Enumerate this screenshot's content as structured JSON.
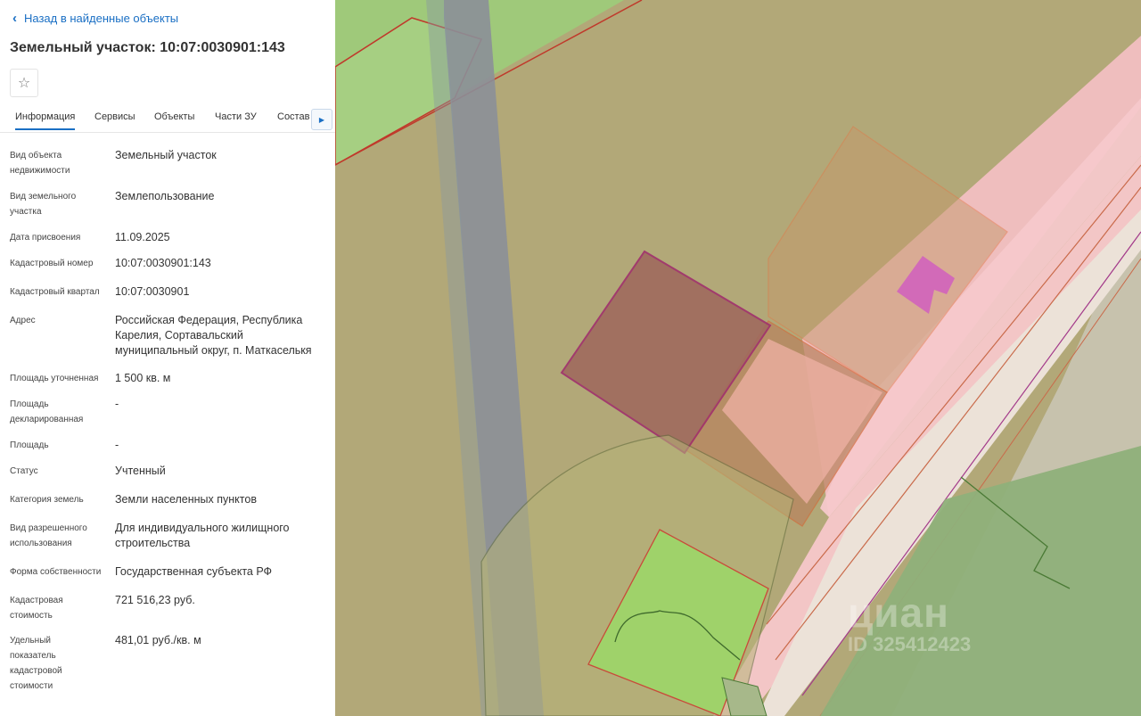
{
  "nav": {
    "back_label": "Назад в найденные объекты"
  },
  "header": {
    "title": "Земельный участок: 10:07:0030901:143"
  },
  "tabs": [
    {
      "label": "Информация",
      "active": true
    },
    {
      "label": "Сервисы"
    },
    {
      "label": "Объекты"
    },
    {
      "label": "Части ЗУ"
    },
    {
      "label": "Состав"
    }
  ],
  "details": [
    {
      "label": "Вид объекта недвижимости",
      "value": "Земельный участок"
    },
    {
      "label": "Вид земельного участка",
      "value": "Землепользование"
    },
    {
      "label": "Дата присвоения",
      "value": "11.09.2025"
    },
    {
      "label": "Кадастровый номер",
      "value": "10:07:0030901:143"
    },
    {
      "label": "Кадастровый квартал",
      "value": "10:07:0030901"
    },
    {
      "label": "Адрес",
      "value": "Российская Федерация, Республика Карелия, Сортавальский муниципальный округ, п. Маткаселькя"
    },
    {
      "label": "Площадь уточненная",
      "value": "1 500 кв. м"
    },
    {
      "label": "Площадь декларированная",
      "value": "-"
    },
    {
      "label": "Площадь",
      "value": "-"
    },
    {
      "label": "Статус",
      "value": "Учтенный"
    },
    {
      "label": "Категория земель",
      "value": "Земли населенных пунктов"
    },
    {
      "label": "Вид разрешенного использования",
      "value": "Для индивидуального жилищного строительства"
    },
    {
      "label": "Форма собственности",
      "value": "Государственная субъекта РФ"
    },
    {
      "label": "Кадастровая стоимость",
      "value": "721 516,23 руб."
    },
    {
      "label": "Удельный показатель кадастровой стоимости",
      "value": "481,01 руб./кв. м"
    }
  ],
  "map": {
    "watermark_logo": "циан",
    "watermark_id": "ID 325412423"
  },
  "colors": {
    "accent": "#1a6fc4",
    "parcel_selected": "#a0306c",
    "zone_pink": "#f7c4c8",
    "green_area": "#9ccf6b"
  },
  "icons": {
    "back": "chevron-left-icon",
    "favorite": "star-icon",
    "tabs_scroll": "chevron-right-icon"
  }
}
